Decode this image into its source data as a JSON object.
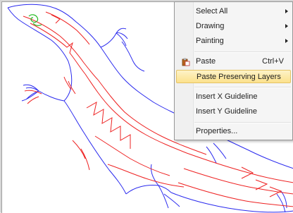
{
  "context_menu": {
    "items": [
      {
        "label": "Select All",
        "submenu": true
      },
      {
        "label": "Drawing",
        "submenu": true
      },
      {
        "label": "Painting",
        "submenu": true
      },
      {
        "label": "Paste",
        "shortcut": "Ctrl+V",
        "icon": "paste-icon"
      },
      {
        "label": "Paste Preserving Layers",
        "highlighted": true
      },
      {
        "label": "Insert X Guideline"
      },
      {
        "label": "Insert Y Guideline"
      },
      {
        "label": "Properties..."
      }
    ]
  },
  "colors": {
    "outline": "#2a2aee",
    "detail": "#ee2222",
    "eye": "#22bb22",
    "highlight": "#fce28c"
  }
}
